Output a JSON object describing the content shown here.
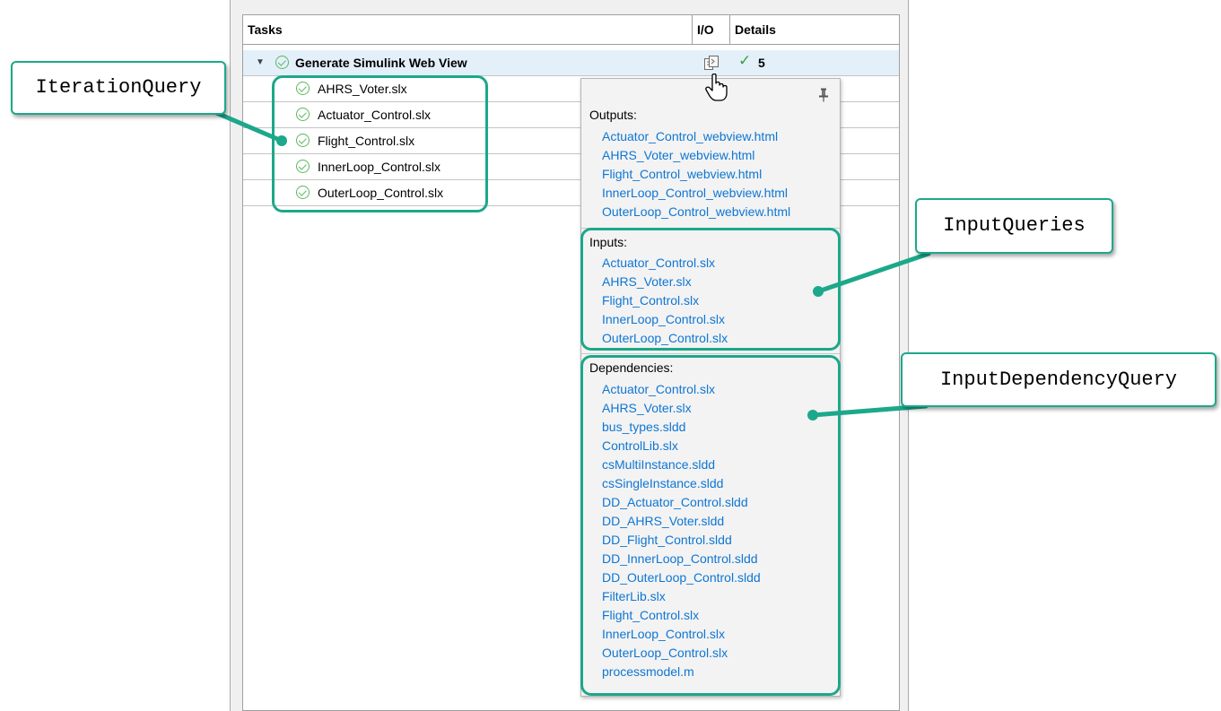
{
  "table": {
    "headers": {
      "tasks": "Tasks",
      "io": "I/O",
      "details": "Details"
    },
    "parent_task": {
      "label": "Generate Simulink Web View",
      "details_count": "5"
    },
    "child_tasks": [
      "AHRS_Voter.slx",
      "Actuator_Control.slx",
      "Flight_Control.slx",
      "InnerLoop_Control.slx",
      "OuterLoop_Control.slx"
    ]
  },
  "popup": {
    "outputs_title": "Outputs:",
    "outputs": [
      "Actuator_Control_webview.html",
      "AHRS_Voter_webview.html",
      "Flight_Control_webview.html",
      "InnerLoop_Control_webview.html",
      "OuterLoop_Control_webview.html"
    ],
    "inputs_title": "Inputs:",
    "inputs": [
      "Actuator_Control.slx",
      "AHRS_Voter.slx",
      "Flight_Control.slx",
      "InnerLoop_Control.slx",
      "OuterLoop_Control.slx"
    ],
    "dependencies_title": "Dependencies:",
    "dependencies": [
      "Actuator_Control.slx",
      "AHRS_Voter.slx",
      "bus_types.sldd",
      "ControlLib.slx",
      "csMultiInstance.sldd",
      "csSingleInstance.sldd",
      "DD_Actuator_Control.sldd",
      "DD_AHRS_Voter.sldd",
      "DD_Flight_Control.sldd",
      "DD_InnerLoop_Control.sldd",
      "DD_OuterLoop_Control.sldd",
      "FilterLib.slx",
      "Flight_Control.slx",
      "InnerLoop_Control.slx",
      "OuterLoop_Control.slx",
      "processmodel.m"
    ]
  },
  "callouts": {
    "iteration": "IterationQuery",
    "inputs": "InputQueries",
    "dependency": "InputDependencyQuery"
  },
  "colors": {
    "accent": "#1ca88a",
    "link": "#0e76d4",
    "check": "#5cb85c",
    "selected_row": "#e3f0fa"
  }
}
